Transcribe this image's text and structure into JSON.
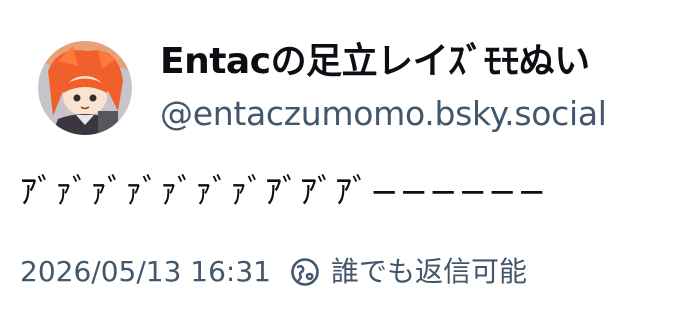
{
  "author": {
    "display_name": "Entacの足立レイｽﾞﾓﾓぬい",
    "handle": "@entaczumomo.bsky.social",
    "avatar_icon": "avatar-image"
  },
  "post": {
    "text": "ｱﾞｧﾞｧﾞｧﾞｧﾞｧﾞｧﾞｱﾞｱﾞｱﾞ−−−−−−"
  },
  "meta": {
    "timestamp": "2026/05/13 16:31",
    "reply_icon": "globe-reply-icon",
    "reply_setting": "誰でも返信可能"
  },
  "colors": {
    "text_primary": "#0b0f14",
    "text_secondary": "#42576c",
    "background": "#ffffff"
  }
}
